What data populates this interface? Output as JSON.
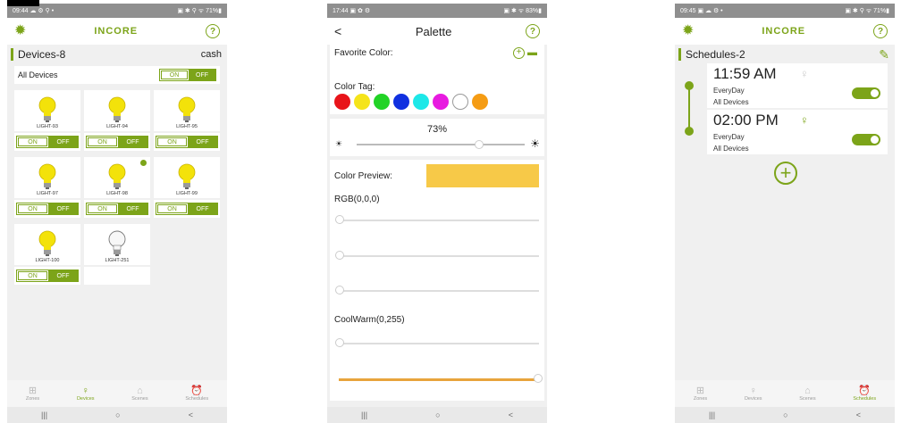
{
  "screen1": {
    "status_left": "09:44 ☁ ⚙ ⚲ •",
    "status_right": "▣ ✱ ⚲ ᯤ 71%▮",
    "brand": "INCORE",
    "help": "?",
    "title": "Devices-8",
    "right_label": "cash",
    "all_devices_label": "All Devices",
    "on_label": "ON",
    "off_label": "OFF",
    "devices": [
      {
        "name": "LIGHT-93"
      },
      {
        "name": "LIGHT-94"
      },
      {
        "name": "LIGHT-95"
      },
      {
        "name": "LIGHT-97"
      },
      {
        "name": "LIGHT-98"
      },
      {
        "name": "LIGHT-99"
      },
      {
        "name": "LIGHT-100"
      },
      {
        "name": "LIGHT-251"
      }
    ],
    "nav": [
      "Zones",
      "Devices",
      "Scenes",
      "Schedules"
    ]
  },
  "screen2": {
    "status_left": "17:44 ▣ ✿ ⚙",
    "status_right": "▣ ✱ ᯤ 83%▮",
    "title": "Palette",
    "back": "<",
    "help": "?",
    "favorite_label": "Favorite Color:",
    "color_tag_label": "Color Tag:",
    "tag_colors": [
      "#e8141a",
      "#f5e41a",
      "#22d326",
      "#1030e0",
      "#1de8e8",
      "#e81ae0",
      "#ffffff",
      "#f59c14"
    ],
    "brightness": "73%",
    "brightness_value": 0.73,
    "preview_label": "Color Preview:",
    "preview_color": "#f7c948",
    "rgb_label": "RGB(0,0,0)",
    "coolwarm_label": "CoolWarm(0,255)",
    "accent": "#e8a43c"
  },
  "screen3": {
    "status_left": "09:45 ▣ ☁ ⚙ •",
    "status_right": "▣ ✱ ⚲ ᯤ 71%▮",
    "brand": "INCORE",
    "help": "?",
    "title": "Schedules-2",
    "schedules": [
      {
        "time": "11:59 AM",
        "repeat": "EveryDay",
        "target": "All Devices"
      },
      {
        "time": "02:00 PM",
        "repeat": "EveryDay",
        "target": "All Devices"
      }
    ],
    "nav": [
      "Zones",
      "Devices",
      "Scenes",
      "Schedules"
    ]
  },
  "sysnav": {
    "recent": "|||",
    "home": "○",
    "back": "<"
  },
  "accent_color": "#7ca419"
}
